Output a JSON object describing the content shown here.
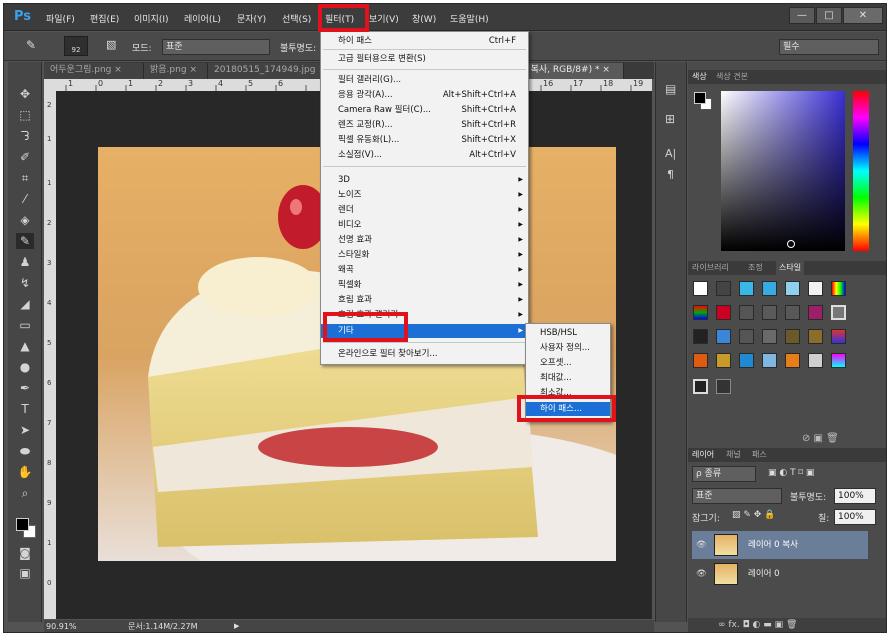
{
  "app": {
    "logo": "Ps"
  },
  "menubar": {
    "items": [
      "파일(F)",
      "편집(E)",
      "이미지(I)",
      "레이어(L)",
      "문자(Y)",
      "선택(S)",
      "필터(T)",
      "보기(V)",
      "창(W)",
      "도움말(H)"
    ],
    "window_controls": [
      "—",
      "□",
      "✕"
    ]
  },
  "options": {
    "brush_size": "92",
    "mode_label": "모드:",
    "mode_value": "표준",
    "opacity_label": "불투명도:",
    "workspace": "필수"
  },
  "tabs": [
    {
      "label": "어두운그림.png",
      "close": "×"
    },
    {
      "label": "밝음.png",
      "close": "×"
    },
    {
      "label": "20180515_174949.jpg",
      "close": "×"
    },
    {
      "label": "0 복사, RGB/8#) *",
      "close": "×"
    }
  ],
  "ruler": {
    "top_labels": [
      "1",
      "0",
      "1",
      "2",
      "3",
      "4",
      "5",
      "6",
      "7",
      "16",
      "17",
      "18",
      "19"
    ],
    "left_labels": [
      "2",
      "1",
      "1",
      "2",
      "3",
      "4",
      "5",
      "6",
      "7",
      "8",
      "9",
      "1",
      "0",
      "1",
      "1",
      "1"
    ]
  },
  "filter_menu": {
    "items": [
      {
        "label": "하이 패스",
        "shortcut": "Ctrl+F"
      },
      {
        "label": "고급 필터용으로 변환(S)",
        "shortcut": ""
      },
      {
        "label": "필터 갤러리(G)...",
        "shortcut": ""
      },
      {
        "label": "응용 광각(A)...",
        "shortcut": "Alt+Shift+Ctrl+A"
      },
      {
        "label": "Camera Raw 필터(C)...",
        "shortcut": "Shift+Ctrl+A"
      },
      {
        "label": "렌즈 교정(R)...",
        "shortcut": "Shift+Ctrl+R"
      },
      {
        "label": "픽셀 유동화(L)...",
        "shortcut": "Shift+Ctrl+X"
      },
      {
        "label": "소실점(V)...",
        "shortcut": "Alt+Ctrl+V"
      },
      {
        "label": "3D",
        "shortcut": ""
      },
      {
        "label": "노이즈",
        "shortcut": ""
      },
      {
        "label": "렌더",
        "shortcut": ""
      },
      {
        "label": "비디오",
        "shortcut": ""
      },
      {
        "label": "선명 효과",
        "shortcut": ""
      },
      {
        "label": "스타일화",
        "shortcut": ""
      },
      {
        "label": "왜곡",
        "shortcut": ""
      },
      {
        "label": "픽셀화",
        "shortcut": ""
      },
      {
        "label": "흐림 효과",
        "shortcut": ""
      },
      {
        "label": "흐림 효과 갤러리",
        "shortcut": ""
      },
      {
        "label": "기타",
        "shortcut": ""
      },
      {
        "label": "온라인으로 필터 찾아보기...",
        "shortcut": ""
      }
    ]
  },
  "other_submenu": {
    "items": [
      "HSB/HSL",
      "사용자 정의...",
      "오프셋...",
      "최대값...",
      "최소값...",
      "하이 패스..."
    ]
  },
  "color_panel": {
    "tabs": [
      "색상",
      "색상 견본"
    ]
  },
  "adjust_panel": {
    "tabs": [
      "라이브러리",
      "조정",
      "스타일"
    ]
  },
  "layers_panel": {
    "tabs": [
      "레이어",
      "채널",
      "패스"
    ],
    "filter_label": "ρ 종류",
    "blend_mode": "표준",
    "opacity_label": "불투명도:",
    "opacity_value": "100%",
    "lock_label": "잠그기:",
    "fill_label": "칠:",
    "fill_value": "100%",
    "layers": [
      {
        "name": "레이어 0 복사",
        "selected": true
      },
      {
        "name": "레이어 0",
        "selected": false
      }
    ],
    "footer_icons": "∞ fx. ◘ ◐ ▬ ▣ 🗑"
  },
  "mini_panel": {
    "items": [
      "A|",
      "¶"
    ]
  },
  "status": {
    "zoom": "90.91%",
    "doc": "문서:1.14M/2.27M"
  },
  "colors": {
    "accent": "#1c6fd4",
    "highlight": "#e0121b",
    "fg": "#000000",
    "bg": "#ffffff"
  }
}
